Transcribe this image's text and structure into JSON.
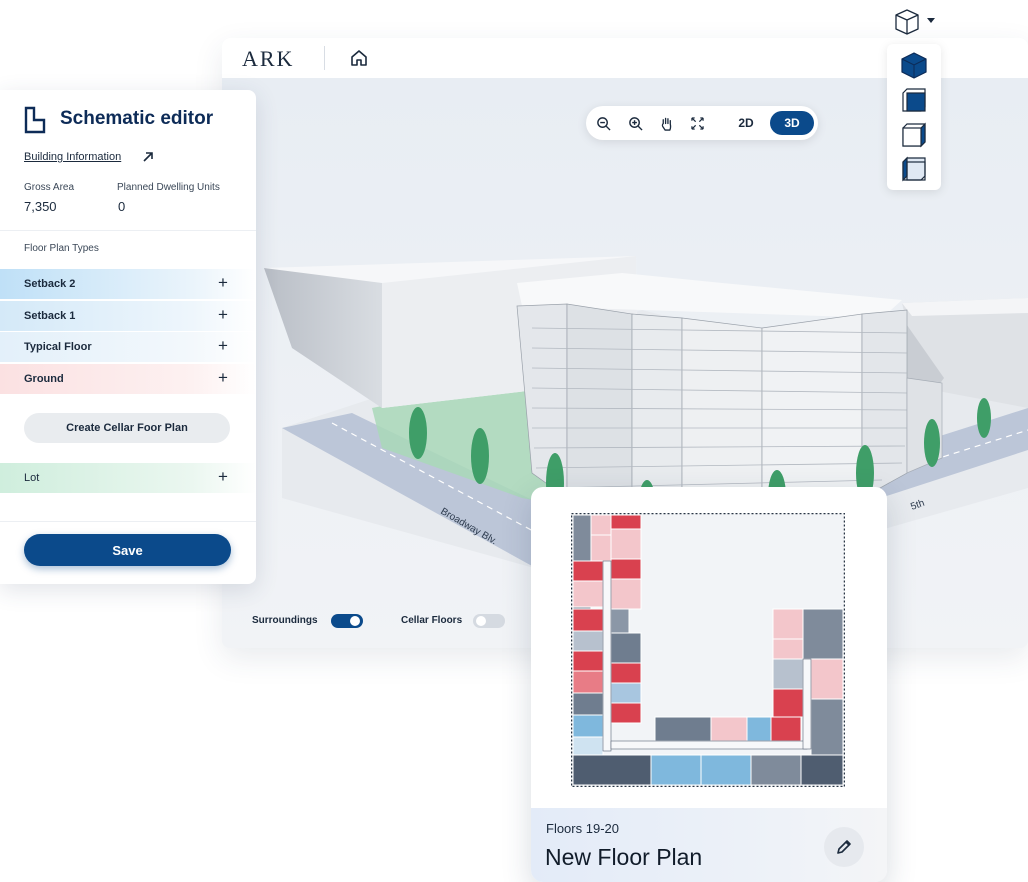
{
  "app": {
    "brand": "ARK",
    "home_icon": "home-icon"
  },
  "toolbar": {
    "icons": [
      "zoom-out-icon",
      "zoom-in-icon",
      "pan-hand-icon",
      "fit-view-icon"
    ],
    "mode_2d": "2D",
    "mode_3d": "3D",
    "active_mode": "3D"
  },
  "view_mode_menu": {
    "trigger_icon": "wireframe-cube-icon",
    "options": [
      "solid-cube-icon",
      "front-face-cube-icon",
      "side-face-cube-icon",
      "outline-cube-icon"
    ]
  },
  "scene": {
    "street_labels": [
      "Broadway Blv.",
      "5th"
    ]
  },
  "toggles": {
    "surroundings": {
      "label": "Surroundings",
      "on": true
    },
    "cellar_floors": {
      "label": "Cellar Floors",
      "on": false
    }
  },
  "editor": {
    "title": "Schematic editor",
    "building_info_link": "Building Information",
    "stats": {
      "gross_area_label": "Gross Area",
      "gross_area_value": "7,350",
      "dwelling_units_label": "Planned Dwelling Units",
      "dwelling_units_value": "0"
    },
    "floor_plan_types_heading": "Floor Plan Types",
    "floor_plan_types": [
      {
        "label": "Setback 2"
      },
      {
        "label": "Setback 1"
      },
      {
        "label": "Typical Floor"
      },
      {
        "label": "Ground"
      }
    ],
    "plus_glyph": "+",
    "create_cellar_label": "Create Cellar Foor Plan",
    "lot_label": "Lot",
    "save_label": "Save"
  },
  "floor_plan_card": {
    "floors": "Floors 19-20",
    "name": "New Floor Plan",
    "edit_icon": "pencil-icon"
  },
  "colors": {
    "primary": "#0b4a8b",
    "title_navy": "#0d2b57",
    "unit_red": "#d9414f",
    "unit_pink": "#f3c6cb",
    "unit_blue": "#7fb8dd",
    "unit_slate": "#7f8b9b",
    "lot_green": "#cfeedd",
    "setback2_blue": "#bfe0f7"
  }
}
